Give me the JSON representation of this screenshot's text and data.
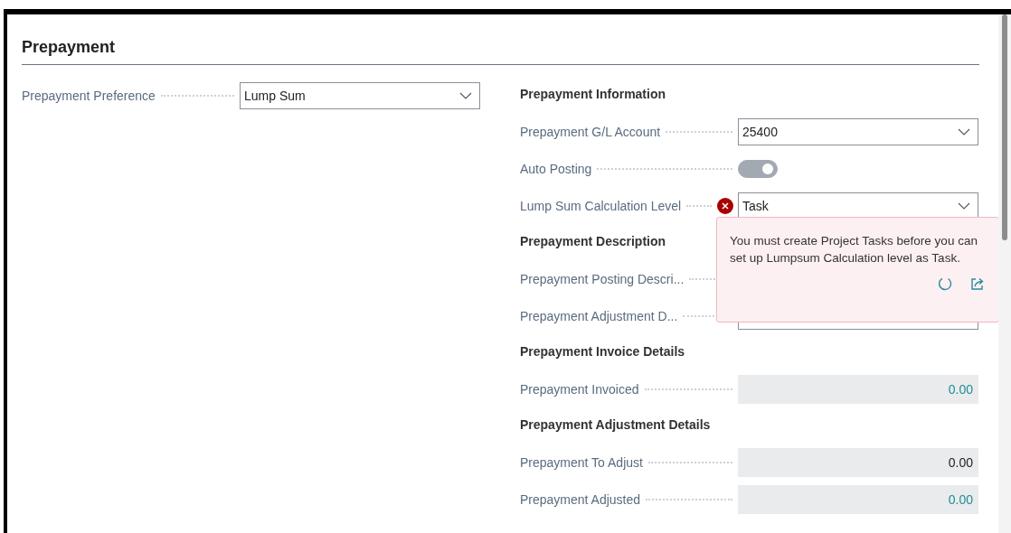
{
  "section": {
    "title": "Prepayment"
  },
  "left_fields": [
    {
      "kind": "dropdown",
      "label": "Prepayment Preference",
      "value": "Lump Sum"
    }
  ],
  "right_fields": [
    {
      "kind": "heading",
      "label": "Prepayment Information"
    },
    {
      "kind": "dropdown",
      "label": "Prepayment  G/L Account",
      "value": "25400"
    },
    {
      "kind": "toggle",
      "label": "Auto Posting",
      "on": true,
      "disabled": true
    },
    {
      "kind": "dropdown",
      "label": "Lump Sum Calculation Level",
      "value": "Task",
      "error": true
    },
    {
      "kind": "heading",
      "label": "Prepayment Description"
    },
    {
      "kind": "label",
      "label": "Prepayment Posting Descri..."
    },
    {
      "kind": "text",
      "label": "Prepayment Adjustment D..."
    },
    {
      "kind": "heading",
      "label": "Prepayment Invoice Details"
    },
    {
      "kind": "readonly",
      "label": "Prepayment Invoiced",
      "value": "0.00",
      "link": true
    },
    {
      "kind": "heading",
      "label": "Prepayment Adjustment Details"
    },
    {
      "kind": "readonly",
      "label": "Prepayment To Adjust",
      "value": "0.00",
      "link": false
    },
    {
      "kind": "readonly",
      "label": "Prepayment Adjusted",
      "value": "0.00",
      "link": true
    }
  ],
  "error_popup": {
    "message": "You must create Project Tasks before you can set up Lumpsum Calculation level as Task."
  }
}
